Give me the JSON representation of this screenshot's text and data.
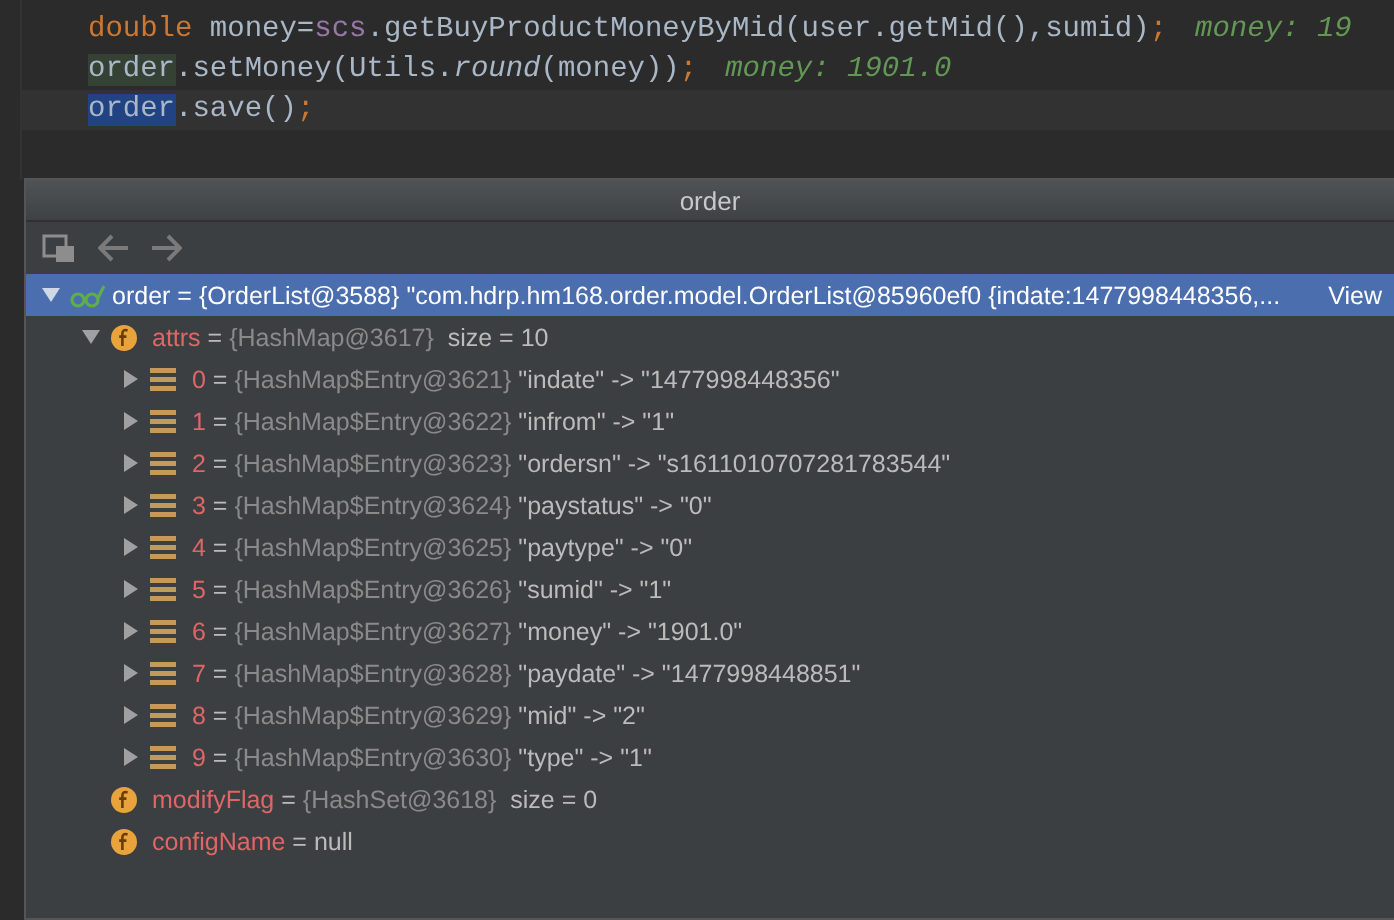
{
  "editor": {
    "lines": [
      {
        "current": false,
        "segments": [
          {
            "kind": "keyword",
            "text": "double"
          },
          {
            "kind": "plain",
            "text": " money="
          },
          {
            "kind": "field",
            "text": "scs"
          },
          {
            "kind": "plain",
            "text": ".getBuyProductMoneyByMid(user.getMid(),sumid)"
          },
          {
            "kind": "punct",
            "text": ";"
          }
        ],
        "hint": "money: 19"
      },
      {
        "current": false,
        "segments": [
          {
            "kind": "highlight",
            "text": "order"
          },
          {
            "kind": "plain",
            "text": ".setMoney(Utils."
          },
          {
            "kind": "italic",
            "text": "round"
          },
          {
            "kind": "plain",
            "text": "(money))"
          },
          {
            "kind": "punct",
            "text": ";"
          }
        ],
        "hint": "money: 1901.0"
      },
      {
        "current": true,
        "segments": [
          {
            "kind": "selection",
            "text": "order"
          },
          {
            "kind": "plain",
            "text": ".save()"
          },
          {
            "kind": "punct",
            "text": ";"
          }
        ]
      }
    ]
  },
  "popup": {
    "title": "order",
    "tree": [
      {
        "kind": "object",
        "name": "order",
        "assign": "=",
        "ref": "{OrderList@3588}",
        "value": "\"com.hdrp.hm168.order.model.OrderList@85960ef0 {indate:1477998448356,...",
        "link": "View",
        "expanded": true,
        "selected": true,
        "children": [
          {
            "kind": "field",
            "name": "attrs",
            "assign": "=",
            "ref": "{HashMap@3617}",
            "value": "size = 10",
            "expanded": true,
            "selected": false,
            "children": [
              {
                "kind": "entry",
                "name": "0",
                "assign": "=",
                "ref": "{HashMap$Entry@3621}",
                "value": "\"indate\" -> \"1477998448356\"",
                "expanded": false,
                "selected": false
              },
              {
                "kind": "entry",
                "name": "1",
                "assign": "=",
                "ref": "{HashMap$Entry@3622}",
                "value": "\"infrom\" -> \"1\"",
                "expanded": false,
                "selected": false
              },
              {
                "kind": "entry",
                "name": "2",
                "assign": "=",
                "ref": "{HashMap$Entry@3623}",
                "value": "\"ordersn\" -> \"s1611010707281783544\"",
                "expanded": false,
                "selected": false
              },
              {
                "kind": "entry",
                "name": "3",
                "assign": "=",
                "ref": "{HashMap$Entry@3624}",
                "value": "\"paystatus\" -> \"0\"",
                "expanded": false,
                "selected": false
              },
              {
                "kind": "entry",
                "name": "4",
                "assign": "=",
                "ref": "{HashMap$Entry@3625}",
                "value": "\"paytype\" -> \"0\"",
                "expanded": false,
                "selected": false
              },
              {
                "kind": "entry",
                "name": "5",
                "assign": "=",
                "ref": "{HashMap$Entry@3626}",
                "value": "\"sumid\" -> \"1\"",
                "expanded": false,
                "selected": false
              },
              {
                "kind": "entry",
                "name": "6",
                "assign": "=",
                "ref": "{HashMap$Entry@3627}",
                "value": "\"money\" -> \"1901.0\"",
                "expanded": false,
                "selected": false
              },
              {
                "kind": "entry",
                "name": "7",
                "assign": "=",
                "ref": "{HashMap$Entry@3628}",
                "value": "\"paydate\" -> \"1477998448851\"",
                "expanded": false,
                "selected": false
              },
              {
                "kind": "entry",
                "name": "8",
                "assign": "=",
                "ref": "{HashMap$Entry@3629}",
                "value": "\"mid\" -> \"2\"",
                "expanded": false,
                "selected": false
              },
              {
                "kind": "entry",
                "name": "9",
                "assign": "=",
                "ref": "{HashMap$Entry@3630}",
                "value": "\"type\" -> \"1\"",
                "expanded": false,
                "selected": false
              }
            ]
          },
          {
            "kind": "field",
            "name": "modifyFlag",
            "assign": "=",
            "ref": "{HashSet@3618}",
            "value": "size = 0",
            "selected": false
          },
          {
            "kind": "field",
            "name": "configName",
            "assign": "=",
            "value": "null",
            "selected": false
          }
        ]
      }
    ]
  }
}
